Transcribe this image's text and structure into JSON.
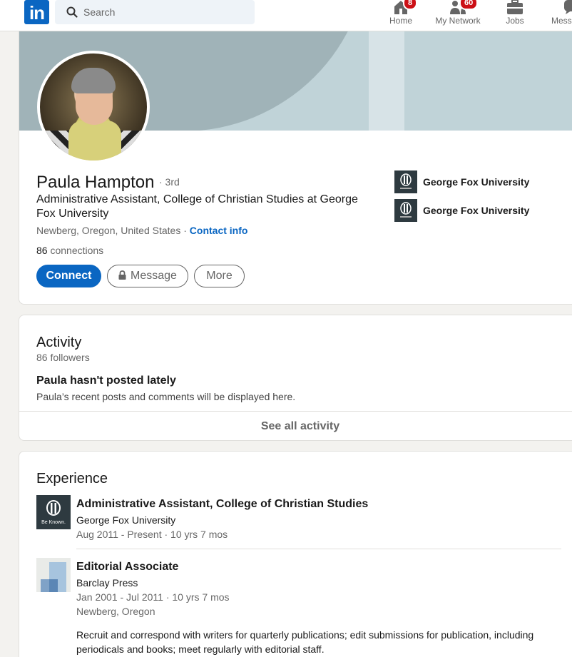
{
  "nav": {
    "search_placeholder": "Search",
    "items": [
      {
        "label": "Home",
        "icon": "home-icon",
        "badge": "8"
      },
      {
        "label": "My Network",
        "icon": "people-icon",
        "badge": "60"
      },
      {
        "label": "Jobs",
        "icon": "briefcase-icon",
        "badge": ""
      },
      {
        "label": "Messaging",
        "icon": "chat-icon",
        "badge": ""
      }
    ],
    "brand_color": "#0a66c2"
  },
  "profile": {
    "name": "Paula Hampton",
    "degree": "· 3rd",
    "headline": "Administrative Assistant, College of Christian Studies at George Fox University",
    "location": "Newberg, Oregon, United States",
    "location_sep": " · ",
    "contact_info": "Contact info",
    "connections_count": "86",
    "connections_label": " connections",
    "actions": {
      "connect": "Connect",
      "message": "Message",
      "more": "More"
    },
    "orgs": [
      {
        "name": "George Fox University"
      },
      {
        "name": "George Fox University"
      }
    ]
  },
  "activity": {
    "title": "Activity",
    "followers": "86 followers",
    "empty_title": "Paula hasn't posted lately",
    "empty_desc": "Paula’s recent posts and comments will be displayed here.",
    "see_all": "See all activity"
  },
  "experience": {
    "title": "Experience",
    "items": [
      {
        "title": "Administrative Assistant, College of Christian Studies",
        "company": "George Fox University",
        "dates": "Aug 2011 - Present · 10 yrs 7 mos",
        "logo_text": "Be Known."
      },
      {
        "title": "Editorial Associate",
        "company": "Barclay Press",
        "dates": "Jan 2001 - Jul 2011 · 10 yrs 7 mos",
        "location": "Newberg, Oregon",
        "description": "Recruit and correspond with writers for quarterly publications; edit submissions for publication, including periodicals and books; meet regularly with editorial staff."
      }
    ]
  }
}
